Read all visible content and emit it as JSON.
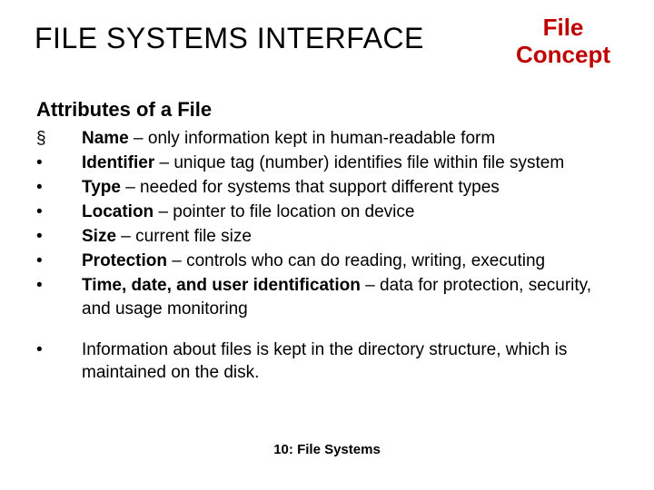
{
  "title_main": "FILE SYSTEMS INTERFACE",
  "title_corner": "File Concept",
  "subhead": "Attributes of a File",
  "bullets": [
    {
      "mark": "§",
      "term": "Name",
      "rest": " – only information kept in human-readable form"
    },
    {
      "mark": "•",
      "term": "Identifier",
      "rest": " – unique tag (number) identifies file within file system"
    },
    {
      "mark": "•",
      "term": "Type",
      "rest": " – needed for systems that support different types"
    },
    {
      "mark": "•",
      "term": "Location",
      "rest": " – pointer to file location on device"
    },
    {
      "mark": "•",
      "term": "Size",
      "rest": " – current file size"
    },
    {
      "mark": "•",
      "term": "Protection",
      "rest": " – controls who can do reading, writing, executing"
    },
    {
      "mark": "•",
      "term": "Time, date, and user identification",
      "rest": " – data for protection, security, and usage monitoring"
    }
  ],
  "note": {
    "mark": "•",
    "text": "Information about files is kept in the directory structure, which is maintained on the disk."
  },
  "footer": "10: File Systems"
}
